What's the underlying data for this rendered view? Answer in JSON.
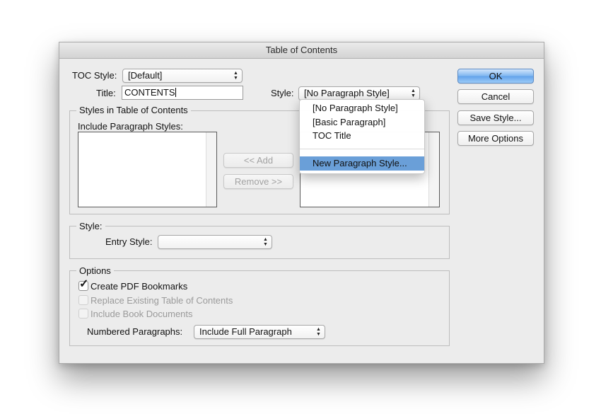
{
  "window": {
    "title": "Table of Contents"
  },
  "toc_style": {
    "label": "TOC Style:",
    "value": "[Default]"
  },
  "title_field": {
    "label": "Title:",
    "value": "CONTENTS"
  },
  "title_style": {
    "label": "Style:",
    "value": "[No Paragraph Style]"
  },
  "styles_group": {
    "label": "Styles in Table of Contents",
    "include_label": "Include Paragraph Styles:",
    "add_button": "<< Add",
    "remove_button": "Remove >>"
  },
  "style_menu": {
    "items": [
      "[No Paragraph Style]",
      "[Basic Paragraph]",
      "TOC Title"
    ],
    "new_item": "New Paragraph Style..."
  },
  "style_group": {
    "label": "Style:",
    "entry_label": "Entry Style:",
    "entry_value": ""
  },
  "options_group": {
    "label": "Options",
    "create_pdf": {
      "label": "Create PDF Bookmarks",
      "checked": true
    },
    "replace_existing": {
      "label": "Replace Existing Table of Contents",
      "checked": false
    },
    "include_book": {
      "label": "Include Book Documents",
      "checked": false
    },
    "numbered_label": "Numbered Paragraphs:",
    "numbered_value": "Include Full Paragraph"
  },
  "buttons": {
    "ok": "OK",
    "cancel": "Cancel",
    "save_style": "Save Style...",
    "more_options": "More Options"
  },
  "colors": {
    "accent": "#6a9fd8",
    "dialog_bg": "#ececec"
  }
}
